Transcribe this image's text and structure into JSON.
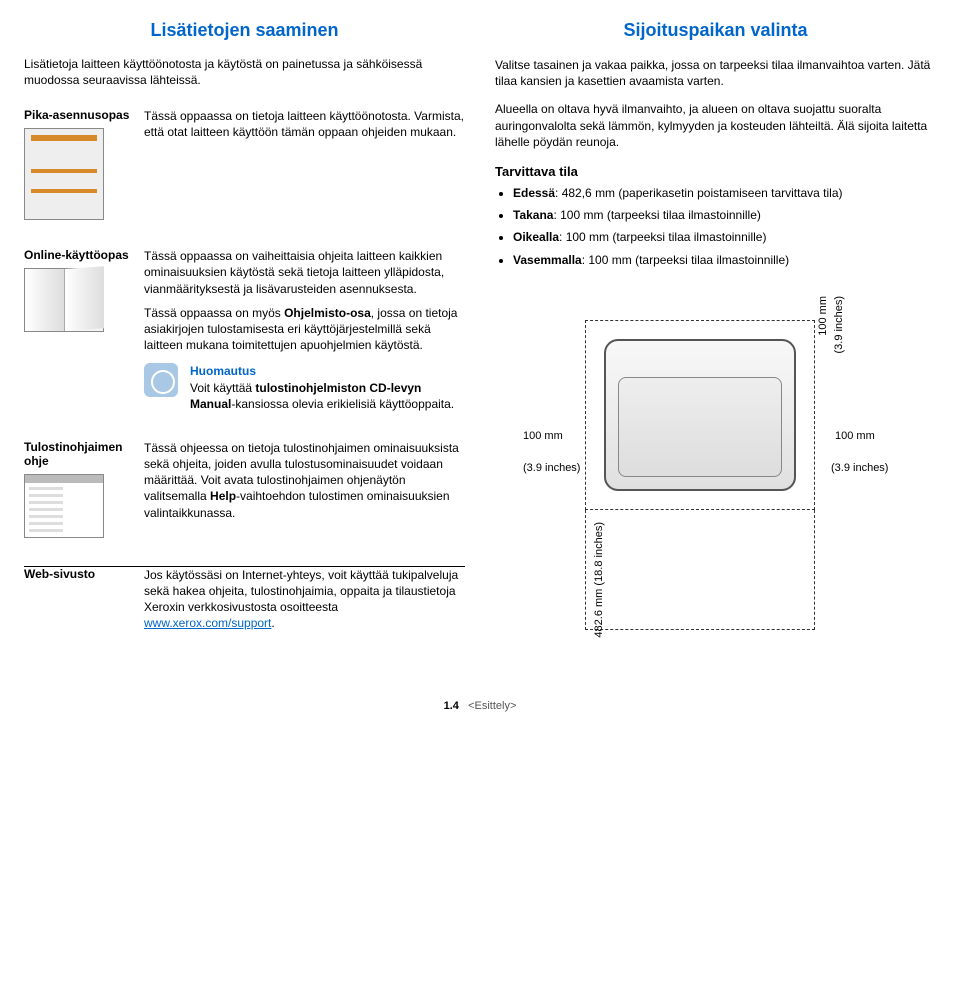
{
  "left": {
    "heading": "Lisätietojen saaminen",
    "intro": "Lisätietoja laitteen käyttöönotosta ja käytöstä on painetussa ja sähköisessä muodossa seuraavissa lähteissä.",
    "rows": {
      "quick": {
        "title": "Pika-asennusopas",
        "desc": "Tässä oppaassa on tietoja laitteen käyttöönotosta. Varmista, että otat laitteen käyttöön tämän oppaan ohjeiden mukaan."
      },
      "online": {
        "title": "Online-käyttöopas",
        "desc1": "Tässä oppaassa on vaiheittaisia ohjeita laitteen kaikkien ominaisuuksien käytöstä sekä tietoja laitteen ylläpidosta, vianmäärityksestä ja lisävarusteiden asennuksesta.",
        "desc2_a": "Tässä oppaassa on myös ",
        "desc2_b": "Ohjelmisto-osa",
        "desc2_c": ", jossa on tietoja asiakirjojen tulostamisesta eri käyttöjärjestelmillä sekä laitteen mukana toimitettujen apuohjelmien käytöstä.",
        "note_title": "Huomautus",
        "note_a": "Voit käyttää ",
        "note_b": "tulostinohjelmiston CD-levyn Manual",
        "note_c": "-kansiossa olevia erikielisiä käyttöoppaita."
      },
      "driver": {
        "title": "Tulostinohjaimen ohje",
        "desc_a": "Tässä ohjeessa on tietoja tulostinohjaimen ominaisuuksista sekä ohjeita, joiden avulla tulostusominaisuudet voidaan määrittää. Voit avata tulostinohjaimen ohjenäytön valitsemalla ",
        "desc_b": "Help",
        "desc_c": "-vaihtoehdon tulostimen ominaisuuksien valintaikkunassa."
      },
      "web": {
        "title": "Web-sivusto",
        "desc_a": "Jos käytössäsi on Internet-yhteys, voit käyttää tukipalveluja sekä hakea ohjeita, tulostinohjaimia, oppaita ja tilaustietoja Xeroxin verkkosivustosta osoitteesta ",
        "link": "www.xerox.com/support",
        "desc_b": "."
      }
    }
  },
  "right": {
    "heading": "Sijoituspaikan valinta",
    "p1": "Valitse tasainen ja vakaa paikka, jossa on tarpeeksi tilaa ilmanvaihtoa varten. Jätä tilaa kansien ja kasettien avaamista varten.",
    "p2": "Alueella on oltava hyvä ilmanvaihto, ja alueen on oltava suojattu suoralta auringonvalolta sekä lämmön, kylmyyden ja kosteuden lähteiltä. Älä sijoita laitetta lähelle pöydän reunoja.",
    "sub": "Tarvittava tila",
    "bullets": {
      "b1a": "Edessä",
      "b1b": ": 482,6 mm (paperikasetin poistamiseen tarvittava tila)",
      "b2a": "Takana",
      "b2b": ": 100 mm (tarpeeksi tilaa ilmastoinnille)",
      "b3a": "Oikealla",
      "b3b": ": 100 mm (tarpeeksi tilaa ilmastoinnille)",
      "b4a": "Vasemmalla",
      "b4b": ": 100 mm (tarpeeksi tilaa ilmastoinnille)"
    },
    "dims": {
      "mm100": "100 mm",
      "in39": "(3.9 inches)",
      "mm_bottom": "482.6 mm (18.8 inches)",
      "mm100_top_v": "100 mm",
      "in39_top_v": "(3.9 inches)"
    }
  },
  "footer": {
    "page": "1.4",
    "chapter": "<Esittely>"
  }
}
